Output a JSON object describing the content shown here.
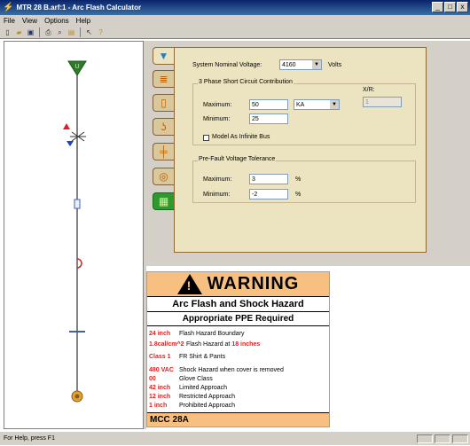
{
  "window": {
    "title": "MTR 28 B.arf:1 - Arc Flash Calculator",
    "minimize": "_",
    "restore": "□",
    "close": "x"
  },
  "menu": [
    "File",
    "View",
    "Options",
    "Help"
  ],
  "toolbar": [
    "new-icon",
    "open-icon",
    "save-icon",
    "print-icon",
    "print-preview-icon",
    "export-icon",
    "help-cursor-icon",
    "info-icon"
  ],
  "oneline": {
    "source_label": "U"
  },
  "tabs": [
    "source-tab",
    "breaker-tab",
    "fuse-tab",
    "cable-tab",
    "transformer-tab",
    "motor-tab",
    "label-tab"
  ],
  "form": {
    "nominal_voltage_label": "System Nominal Voltage:",
    "nominal_voltage_value": "4160",
    "volts_label": "Volts",
    "sc_group_label": "3 Phase Short Circuit Contribution",
    "xr_label": "X/R:",
    "xr_value": "1",
    "sc_max_label": "Maximum:",
    "sc_max_value": "50",
    "sc_unit": "KA",
    "sc_min_label": "Minimum:",
    "sc_min_value": "25",
    "infinite_bus_label": "Model As Infinite Bus",
    "prefault_group_label": "Pre-Fault Voltage Tolerance",
    "pf_max_label": "Maximum:",
    "pf_max_value": "3",
    "pf_min_label": "Minimum:",
    "pf_min_value": "-2",
    "pct": "%"
  },
  "warning": {
    "title": "WARNING",
    "bang": "!",
    "subtitle": "Arc Flash and Shock Hazard",
    "ppe": "Appropriate PPE Required",
    "rows": [
      {
        "value": "24 inch",
        "text": "Flash Hazard Boundary"
      },
      {
        "value": "1.8cal/cm^2",
        "text": "Flash Hazard at",
        "extra": "18 inches"
      },
      {
        "value": "Class 1",
        "text": "FR Shirt & Pants"
      },
      {
        "value": "480 VAC",
        "text": "Shock Hazard when cover is removed"
      },
      {
        "value": "00",
        "text": "Glove Class"
      },
      {
        "value": "42 inch",
        "text": "Limited Approach"
      },
      {
        "value": "12 inch",
        "text": "Restricted Approach"
      },
      {
        "value": "1 inch",
        "text": "Prohibited Approach"
      }
    ],
    "footer": "MCC 28A"
  },
  "status": {
    "text": "For Help, press F1"
  },
  "colors": {
    "titlebar": "#0a246a",
    "panel": "#ece4c0",
    "warning_orange": "#f8c080",
    "red": "#e02020",
    "source_green": "#2e7a2e"
  }
}
